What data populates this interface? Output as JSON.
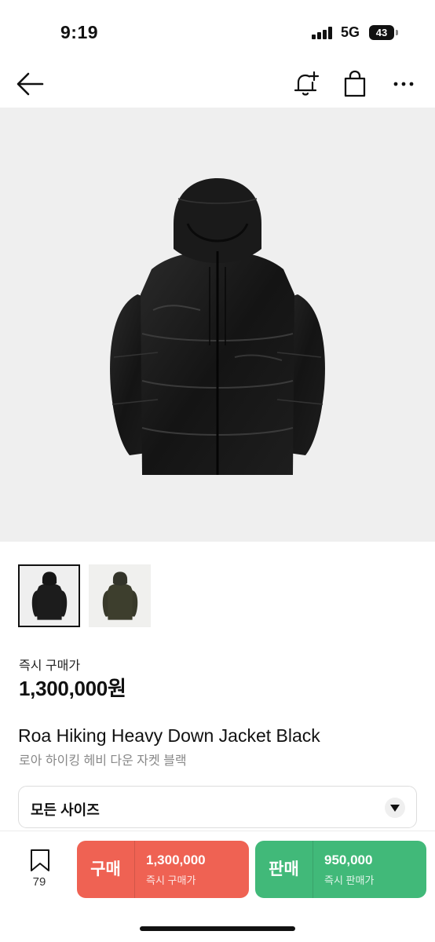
{
  "status_bar": {
    "time": "9:19",
    "network": "5G",
    "battery": "43"
  },
  "nav": {
    "icons": [
      "back-arrow-icon",
      "bell-plus-icon",
      "shopping-bag-icon",
      "more-horizontal-icon"
    ]
  },
  "product": {
    "image": "black-down-jacket",
    "thumbnails": [
      {
        "name": "black-jacket-thumbnail",
        "selected": true
      },
      {
        "name": "olive-jacket-thumbnail",
        "selected": false
      }
    ],
    "price_label": "즉시 구매가",
    "price": "1,300,000원",
    "name_en": "Roa Hiking Heavy Down Jacket Black",
    "name_ko": "로아 하이킹 헤비 다운 자켓 블랙"
  },
  "size_select": {
    "label": "모든 사이즈"
  },
  "bottom_bar": {
    "bookmark_count": "79",
    "buy": {
      "label": "구매",
      "price": "1,300,000",
      "sub": "즉시 구매가",
      "color": "#ef6253"
    },
    "sell": {
      "label": "판매",
      "price": "950,000",
      "sub": "즉시 판매가",
      "color": "#41b979"
    }
  }
}
